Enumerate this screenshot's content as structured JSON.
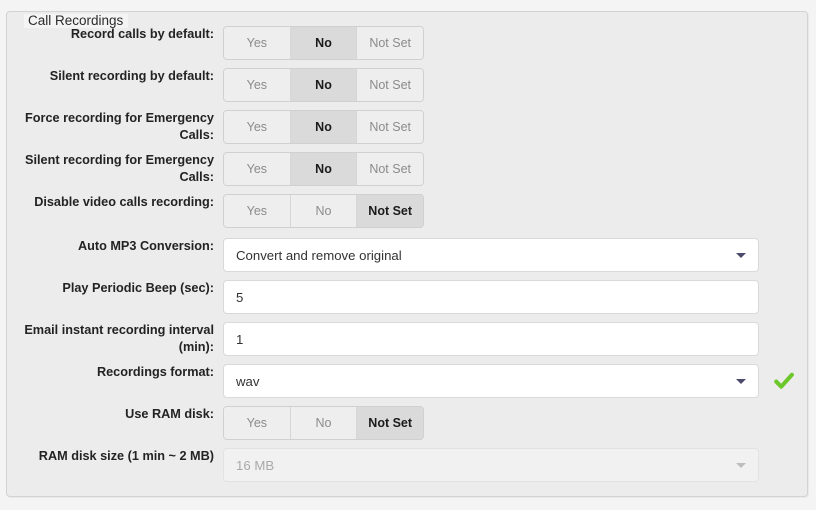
{
  "panel": {
    "legend": "Call Recordings"
  },
  "rows": [
    {
      "id": "record-calls-by-default",
      "label": "Record calls by default:",
      "type": "tristate",
      "options": [
        "Yes",
        "No",
        "Not Set"
      ],
      "selected": "No"
    },
    {
      "id": "silent-recording-by-default",
      "label": "Silent recording by default:",
      "type": "tristate",
      "options": [
        "Yes",
        "No",
        "Not Set"
      ],
      "selected": "No"
    },
    {
      "id": "force-recording-emergency-calls",
      "label": "Force recording for Emergency Calls:",
      "type": "tristate",
      "options": [
        "Yes",
        "No",
        "Not Set"
      ],
      "selected": "No"
    },
    {
      "id": "silent-recording-emergency-calls",
      "label": "Silent recording for Emergency Calls:",
      "type": "tristate",
      "options": [
        "Yes",
        "No",
        "Not Set"
      ],
      "selected": "No"
    },
    {
      "id": "disable-video-calls-recording",
      "label": "Disable video calls recording:",
      "type": "tristate",
      "options": [
        "Yes",
        "No",
        "Not Set"
      ],
      "selected": "Not Set"
    },
    {
      "id": "auto-mp3-conversion",
      "label": "Auto MP3 Conversion:",
      "type": "select",
      "value": "Convert and remove original"
    },
    {
      "id": "play-periodic-beep",
      "label": "Play Periodic Beep (sec):",
      "type": "text",
      "value": "5"
    },
    {
      "id": "email-instant-recording-interval",
      "label": "Email instant recording interval (min):",
      "type": "text",
      "value": "1"
    },
    {
      "id": "recordings-format",
      "label": "Recordings format:",
      "type": "select",
      "value": "wav",
      "status_icon": "check-icon"
    },
    {
      "id": "use-ram-disk",
      "label": "Use RAM disk:",
      "type": "tristate",
      "options": [
        "Yes",
        "No",
        "Not Set"
      ],
      "selected": "Not Set"
    },
    {
      "id": "ram-disk-size",
      "label": "RAM disk size (1 min ~ 2 MB)",
      "type": "select",
      "value": "16 MB",
      "disabled": true
    }
  ],
  "colors": {
    "page_background": "#f4f4f4",
    "panel_background": "#ececec",
    "segment_unselected": "#eeeeee",
    "segment_selected": "#dadada",
    "field_background": "#ffffff",
    "status_check": "#6cc82a"
  }
}
